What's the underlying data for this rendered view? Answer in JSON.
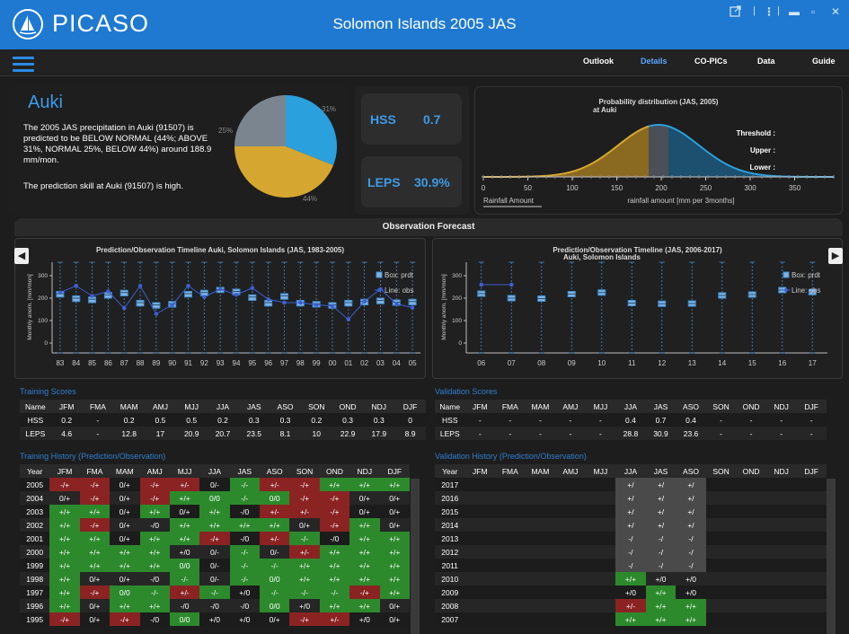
{
  "header": {
    "logo": "PICASO",
    "title": "Solomon Islands 2005 JAS",
    "icons": [
      "external-link-icon",
      "kebab-icon",
      "minimize-icon",
      "maximize-icon",
      "close-icon"
    ]
  },
  "nav": {
    "tabs": [
      "Outlook",
      "Details",
      "CO-PICs",
      "Data",
      "Guide"
    ],
    "active": "Details"
  },
  "station": {
    "name": "Auki",
    "description": "The 2005 JAS precipitation in Auki (91507) is predicted to be BELOW NORMAL (44%; ABOVE 31%, NORMAL 25%, BELOW 44%) around 188.9 mm/mon.",
    "skill_text": "The prediction skill at Auki (91507) is high."
  },
  "pie": {
    "above_label": "31%",
    "normal_label": "25%",
    "below_label": "44%",
    "above": 31,
    "normal": 25,
    "below": 44,
    "colors": {
      "above": "#2aa0dc",
      "normal": "#7a8590",
      "below": "#d6a730"
    }
  },
  "scores": {
    "hss_label": "HSS",
    "hss_value": "0.7",
    "leps_label": "LEPS",
    "leps_value": "30.9%"
  },
  "prob_dist": {
    "title": "Probability distribution (JAS, 2005)",
    "subtitle": "at Auki",
    "threshold": "Threshold :",
    "upper": "Upper :",
    "lower": "Lower :",
    "x_ticks": [
      "0",
      "50",
      "100",
      "150",
      "200",
      "250",
      "300",
      "350"
    ],
    "legend": "Rainfall Amount",
    "xlabel": "rainfall amount [mm per 3months]"
  },
  "section_title": "Observation Forecast",
  "chart_data": [
    {
      "type": "box+line",
      "title": "Prediction/Observation Timeline Auki, Solomon Islands (JAS, 1983-2005)",
      "ylabel": "Monthly anom. [mm/mon]",
      "y_ticks": [
        "0",
        "100",
        "200",
        "300"
      ],
      "ylim": [
        -20,
        340
      ],
      "x": [
        "83",
        "84",
        "85",
        "86",
        "87",
        "88",
        "89",
        "90",
        "91",
        "92",
        "93",
        "94",
        "95",
        "96",
        "97",
        "98",
        "99",
        "00",
        "01",
        "02",
        "03",
        "04",
        "05"
      ],
      "box_median": [
        220,
        200,
        195,
        215,
        225,
        180,
        170,
        175,
        220,
        225,
        238,
        230,
        205,
        180,
        210,
        180,
        175,
        170,
        180,
        185,
        190,
        182,
        185
      ],
      "box_q1": [
        205,
        185,
        180,
        200,
        210,
        165,
        155,
        160,
        205,
        210,
        225,
        215,
        190,
        165,
        195,
        165,
        160,
        155,
        165,
        170,
        175,
        168,
        170
      ],
      "box_q3": [
        230,
        210,
        205,
        225,
        235,
        190,
        180,
        185,
        230,
        235,
        248,
        240,
        215,
        190,
        220,
        190,
        185,
        180,
        190,
        195,
        200,
        192,
        195
      ],
      "obs": [
        225,
        255,
        210,
        230,
        155,
        255,
        130,
        170,
        255,
        205,
        240,
        215,
        245,
        195,
        180,
        180,
        170,
        165,
        105,
        185,
        240,
        175,
        158
      ],
      "legend": [
        "Box: prdt",
        "Line: obs"
      ]
    },
    {
      "type": "box+line",
      "title": "Prediction/Observation Timeline (JAS, 2006-2017)",
      "subtitle": "Auki, Solomon Islands",
      "ylabel": "Monthly anom. [mm/mon]",
      "y_ticks": [
        "0",
        "100",
        "200",
        "300"
      ],
      "ylim": [
        -20,
        340
      ],
      "x": [
        "06",
        "07",
        "08",
        "09",
        "10",
        "11",
        "12",
        "13",
        "14",
        "15",
        "16",
        "17"
      ],
      "box_median": [
        220,
        200,
        198,
        218,
        225,
        178,
        175,
        176,
        212,
        216,
        236,
        227
      ],
      "box_q1": [
        208,
        188,
        186,
        206,
        213,
        166,
        163,
        164,
        200,
        204,
        224,
        215
      ],
      "box_q3": [
        232,
        212,
        210,
        230,
        237,
        190,
        187,
        188,
        224,
        228,
        248,
        239
      ],
      "obs": [
        260,
        260,
        null,
        null,
        null,
        null,
        null,
        null,
        null,
        null,
        null,
        null
      ],
      "legend": [
        "Box: prdt",
        "Line: obs"
      ]
    }
  ],
  "training_scores": {
    "title": "Training Scores",
    "head": [
      "Name",
      "JFM",
      "FMA",
      "MAM",
      "AMJ",
      "MJJ",
      "JJA",
      "JAS",
      "ASO",
      "SON",
      "OND",
      "NDJ",
      "DJF"
    ],
    "rows": [
      [
        "HSS",
        "0.2",
        "-",
        "0.2",
        "0.5",
        "0.5",
        "0.2",
        "0.3",
        "0.3",
        "0.2",
        "0.3",
        "0.3",
        "0"
      ],
      [
        "LEPS",
        "4.6",
        "-",
        "12.8",
        "17",
        "20.9",
        "20.7",
        "23.5",
        "8.1",
        "10",
        "22.9",
        "17.9",
        "8.9"
      ]
    ]
  },
  "validation_scores": {
    "title": "Validation Scores",
    "head": [
      "Name",
      "JFM",
      "FMA",
      "MAM",
      "AMJ",
      "MJJ",
      "JJA",
      "JAS",
      "ASO",
      "SON",
      "OND",
      "NDJ",
      "DJF"
    ],
    "rows": [
      [
        "HSS",
        "-",
        "-",
        "-",
        "-",
        "-",
        "0.4",
        "0.7",
        "0.4",
        "-",
        "-",
        "-",
        "-"
      ],
      [
        "LEPS",
        "-",
        "-",
        "-",
        "-",
        "-",
        "28.8",
        "30.9",
        "23.6",
        "-",
        "-",
        "-",
        "-"
      ]
    ]
  },
  "training_history": {
    "title": "Training History (Prediction/Observation)",
    "head": [
      "Year",
      "JFM",
      "FMA",
      "MAM",
      "AMJ",
      "MJJ",
      "JJA",
      "JAS",
      "ASO",
      "SON",
      "OND",
      "NDJ",
      "DJF"
    ],
    "rows": [
      [
        "2005",
        "-/+",
        "-/+",
        "0/+",
        "-/+",
        "+/-",
        "0/-",
        "-/-",
        "+/-",
        "-/+",
        "+/+",
        "+/+",
        "+/+"
      ],
      [
        "2004",
        "0/+",
        "-/+",
        "0/+",
        "-/+",
        "+/+",
        "0/0",
        "-/-",
        "0/0",
        "-/+",
        "-/+",
        "0/+",
        "0/+"
      ],
      [
        "2003",
        "+/+",
        "+/+",
        "0/+",
        "+/+",
        "0/+",
        "+/+",
        "-/0",
        "+/-",
        "+/-",
        "-/+",
        "0/+",
        "0/+"
      ],
      [
        "2002",
        "+/+",
        "-/+",
        "0/+",
        "-/0",
        "+/+",
        "+/+",
        "+/+",
        "+/+",
        "0/+",
        "-/+",
        "+/+",
        "0/+"
      ],
      [
        "2001",
        "+/+",
        "+/+",
        "0/+",
        "+/+",
        "+/+",
        "-/+",
        "-/0",
        "+/-",
        "-/-",
        "-/0",
        "+/+",
        "+/+"
      ],
      [
        "2000",
        "+/+",
        "+/+",
        "+/+",
        "+/+",
        "+/0",
        "0/-",
        "-/-",
        "0/-",
        "+/-",
        "+/+",
        "+/+",
        "+/+"
      ],
      [
        "1999",
        "+/+",
        "+/+",
        "+/+",
        "+/+",
        "0/0",
        "0/-",
        "-/-",
        "-/-",
        "+/+",
        "+/+",
        "+/+",
        "+/+"
      ],
      [
        "1998",
        "+/+",
        "0/+",
        "0/+",
        "-/0",
        "-/-",
        "0/-",
        "-/-",
        "0/0",
        "+/+",
        "+/+",
        "+/+",
        "+/+"
      ],
      [
        "1997",
        "+/+",
        "-/+",
        "0/0",
        "-/-",
        "+/-",
        "-/-",
        "+/0",
        "-/-",
        "-/-",
        "-/-",
        "-/+",
        "+/+"
      ],
      [
        "1996",
        "+/+",
        "0/+",
        "+/+",
        "+/+",
        "-/0",
        "-/0",
        "-/0",
        "0/0",
        "+/0",
        "+/+",
        "+/+",
        "0/+"
      ],
      [
        "1995",
        "-/+",
        "0/+",
        "-/+",
        "-/0",
        "0/0",
        "+/0",
        "+/0",
        "0/+",
        "-/+",
        "+/-",
        "+/0",
        "0/+"
      ]
    ]
  },
  "validation_history": {
    "title": "Validation History (Prediction/Observation)",
    "head": [
      "Year",
      "JFM",
      "FMA",
      "MAM",
      "AMJ",
      "MJJ",
      "JJA",
      "JAS",
      "ASO",
      "SON",
      "OND",
      "NDJ",
      "DJF"
    ],
    "rows": [
      [
        "2017",
        "",
        "",
        "",
        "",
        "",
        "+/",
        "+/",
        "+/",
        "",
        "",
        "",
        ""
      ],
      [
        "2016",
        "",
        "",
        "",
        "",
        "",
        "+/",
        "+/",
        "+/",
        "",
        "",
        "",
        ""
      ],
      [
        "2015",
        "",
        "",
        "",
        "",
        "",
        "+/",
        "+/",
        "+/",
        "",
        "",
        "",
        ""
      ],
      [
        "2014",
        "",
        "",
        "",
        "",
        "",
        "+/",
        "+/",
        "+/",
        "",
        "",
        "",
        ""
      ],
      [
        "2013",
        "",
        "",
        "",
        "",
        "",
        "-/",
        "-/",
        "-/",
        "",
        "",
        "",
        ""
      ],
      [
        "2012",
        "",
        "",
        "",
        "",
        "",
        "-/",
        "-/",
        "-/",
        "",
        "",
        "",
        ""
      ],
      [
        "2011",
        "",
        "",
        "",
        "",
        "",
        "-/",
        "-/",
        "-/",
        "",
        "",
        "",
        ""
      ],
      [
        "2010",
        "",
        "",
        "",
        "",
        "",
        "+/+",
        "+/0",
        "+/0",
        "",
        "",
        "",
        ""
      ],
      [
        "2009",
        "",
        "",
        "",
        "",
        "",
        "+/0",
        "+/+",
        "+/0",
        "",
        "",
        "",
        ""
      ],
      [
        "2008",
        "",
        "",
        "",
        "",
        "",
        "+/-",
        "+/+",
        "+/+",
        "",
        "",
        "",
        ""
      ],
      [
        "2007",
        "",
        "",
        "",
        "",
        "",
        "+/+",
        "+/+",
        "+/+",
        "",
        "",
        "",
        ""
      ]
    ]
  }
}
